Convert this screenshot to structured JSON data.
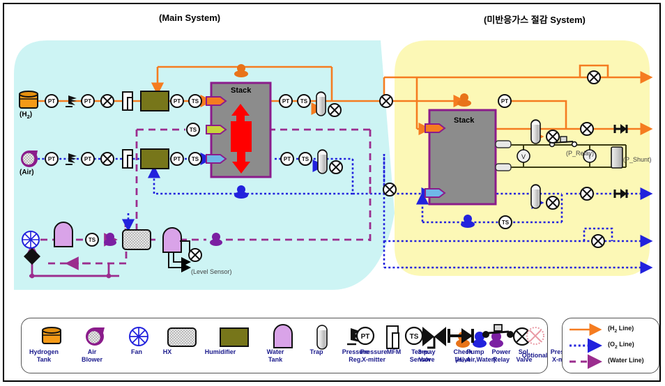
{
  "titles": {
    "main_system": "(Main System)",
    "recovery_system": "(미반응가스 절감 System)"
  },
  "labels": {
    "stack": "Stack",
    "h2_source": "(H₂)",
    "air_source": "(Air)",
    "level_sensor": "(Level Sensor)",
    "p_relay": "(P_Relay)",
    "p_shunt": "(P_Shunt)",
    "pt": "PT",
    "ts": "TS",
    "volt": "V",
    "amp": "I"
  },
  "legend": {
    "items": [
      {
        "icon": "hydrogen-tank-icon",
        "line1": "Hydrogen",
        "line2": "Tank"
      },
      {
        "icon": "air-blower-icon",
        "line1": "Air",
        "line2": "Blower"
      },
      {
        "icon": "fan-icon",
        "line1": "Fan",
        "line2": ""
      },
      {
        "icon": "hx-icon",
        "line1": "HX",
        "line2": ""
      },
      {
        "icon": "humidifier-icon",
        "line1": "Humidifier",
        "line2": ""
      },
      {
        "icon": "water-tank-icon",
        "line1": "Water",
        "line2": "Tank"
      },
      {
        "icon": "trap-icon",
        "line1": "Trap",
        "line2": ""
      },
      {
        "icon": "pressure-regulator-icon",
        "line1": "Pressure",
        "line2": "Reg."
      },
      {
        "icon": "mfm-icon",
        "line1": "MFM",
        "line2": ""
      },
      {
        "icon": "three-way-valve-icon",
        "line1": "3-way",
        "line2": "Valve"
      },
      {
        "icon": "pump-icon",
        "line1": "Pump",
        "line2": "(H₂,Air,Water)"
      },
      {
        "icon": "solenoid-valve-icon",
        "line1": "Sol.",
        "line2": "Valve"
      },
      {
        "icon": "pressure-transmitter-icon",
        "line1": "Pressure",
        "line2": "X-mitter"
      },
      {
        "icon": "temp-sensor-icon",
        "line1": "Temp.",
        "line2": "Sensor"
      },
      {
        "icon": "check-valve-icon",
        "line1": "Check",
        "line2": "Valve"
      },
      {
        "icon": "power-relay-icon",
        "line1": "Power",
        "line2": "Relay"
      },
      {
        "icon": "optional-icon",
        "line1": "Optional",
        "line2": ""
      }
    ],
    "lines": [
      {
        "icon": "h2-line-icon",
        "label": "(H₂ Line)"
      },
      {
        "icon": "o2-line-icon",
        "label": "(O₂ Line)"
      },
      {
        "icon": "water-line-icon",
        "label": "(Water Line)"
      }
    ]
  },
  "colors": {
    "h2_line": "#F57C20",
    "o2_line": "#2222DD",
    "water_line": "#9B2D8E",
    "main_bg": "#CDF4F4",
    "recovery_bg": "#FCF8B6",
    "stack_fill": "#8C8C8C",
    "stack_border": "#8B1C8B",
    "stack_arrow": "#FF0000",
    "humidifier": "#77761A",
    "water_tank": "#D9A3E8",
    "tank_orange": "#F59A17",
    "wire": "#3A3A10",
    "legend_text": "#1a1a8c"
  }
}
